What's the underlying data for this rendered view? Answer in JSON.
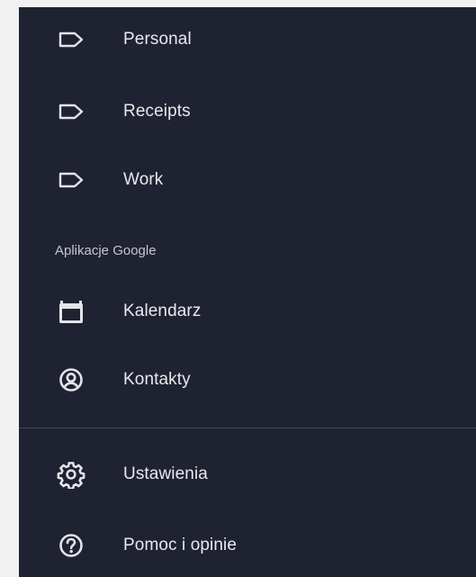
{
  "labels": [
    {
      "label": "Personal",
      "icon": "label-outline-icon"
    },
    {
      "label": "Receipts",
      "icon": "label-outline-icon"
    },
    {
      "label": "Work",
      "icon": "label-outline-icon"
    }
  ],
  "apps_section": {
    "header": "Aplikacje Google",
    "items": [
      {
        "label": "Kalendarz",
        "icon": "calendar-icon"
      },
      {
        "label": "Kontakty",
        "icon": "contacts-icon"
      }
    ]
  },
  "footer": {
    "settings_label": "Ustawienia",
    "settings_icon": "gear-icon",
    "help_label": "Pomoc i opinie",
    "help_icon": "help-circle-icon"
  },
  "colors": {
    "drawer_background": "#1f2230",
    "text": "#e8e9ee",
    "icon": "#e3e4ea",
    "divider": "#434756"
  }
}
